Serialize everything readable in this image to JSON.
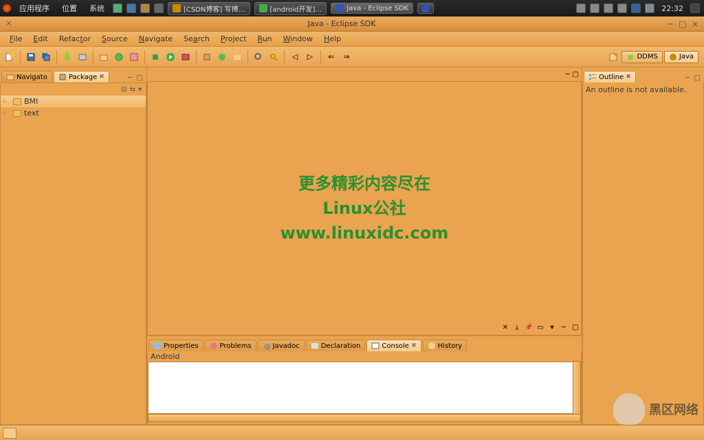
{
  "taskbar": {
    "apps_label": "应用程序",
    "places_label": "位置",
    "system_label": "系统",
    "tasks": [
      {
        "label": "[CSDN博客] 写博…"
      },
      {
        "label": "[android开发]…"
      },
      {
        "label": "Java - Eclipse SDK",
        "active": true
      },
      {
        "label": ""
      }
    ],
    "clock": "22:32"
  },
  "window": {
    "title": "Java - Eclipse SDK"
  },
  "menubar": [
    "File",
    "Edit",
    "Refactor",
    "Source",
    "Navigate",
    "Search",
    "Project",
    "Run",
    "Window",
    "Help"
  ],
  "menubar_acc": [
    "F",
    "E",
    "t",
    "S",
    "N",
    "a",
    "P",
    "R",
    "W",
    "H"
  ],
  "perspectives": {
    "ddms": "DDMS",
    "java": "Java"
  },
  "left_tabs": {
    "navigato": "Navigato",
    "package": "Package"
  },
  "projects": [
    {
      "label": "BMI",
      "selected": true
    },
    {
      "label": "text",
      "selected": false
    }
  ],
  "outline": {
    "title": "Outline",
    "empty_msg": "An outline is not available."
  },
  "bottom_tabs": {
    "properties": "Properties",
    "problems": "Problems",
    "javadoc": "Javadoc",
    "declaration": "Declaration",
    "console": "Console",
    "history": "History"
  },
  "console": {
    "label": "Android"
  },
  "watermark": {
    "line1": "更多精彩内容尽在",
    "line2": "Linux公社",
    "line3": "www.linuxidc.com"
  },
  "footer": {
    "text": "黑区网络"
  }
}
